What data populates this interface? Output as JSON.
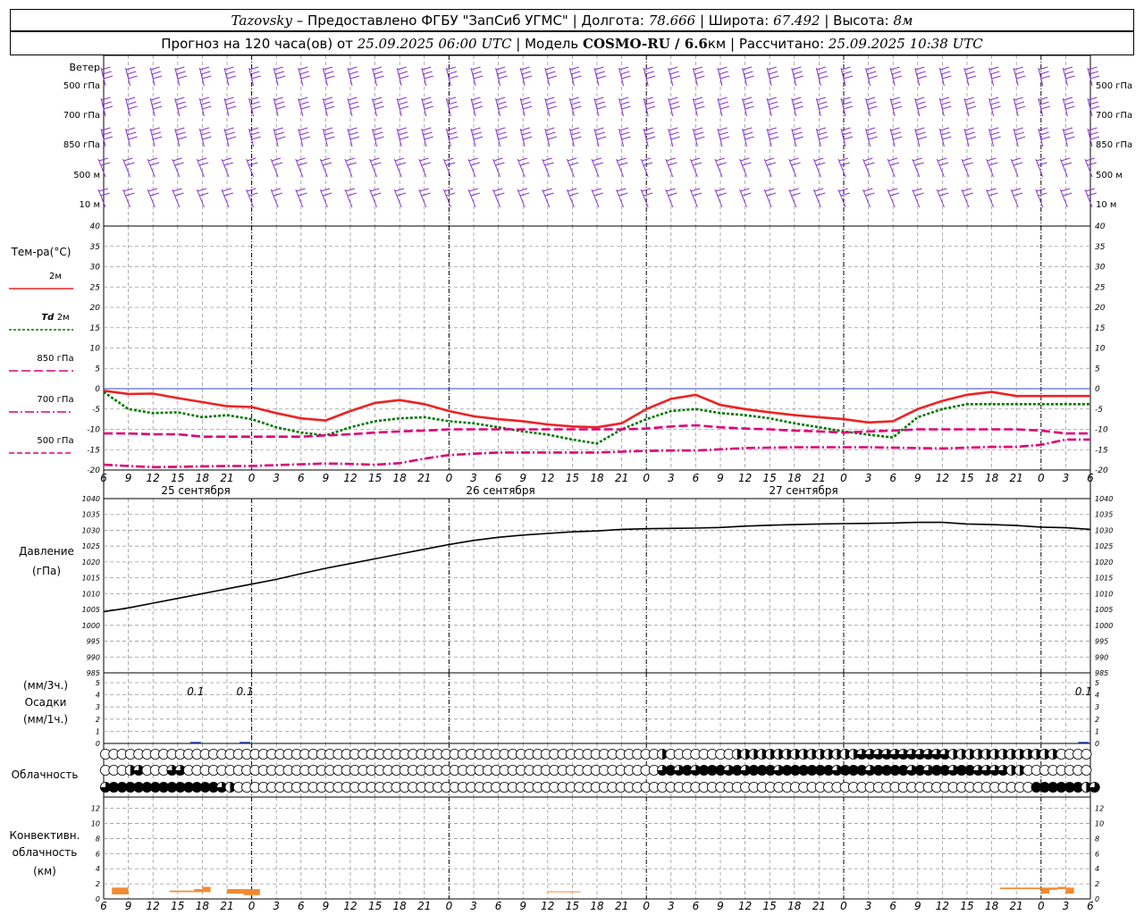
{
  "header": {
    "station": "Tazovsky",
    "provider": " – Предоставлено ФГБУ \"ЗапСиб УГМС\" | ",
    "lon_label": "Долгота: ",
    "lon": "78.666",
    "lat_label": " | Широта: ",
    "lat": "67.492",
    "alt_label": " | Высота: ",
    "alt": "8м",
    "forecast_label": "Прогноз на 120 часа(ов) от ",
    "forecast_start": "25.09.2025 06:00 UTC",
    "model_label": " | Модель ",
    "model": "COSMO-RU / 6.6",
    "model_unit": "км",
    "calc_label": " | Рассчитано: ",
    "calc_time": "25.09.2025 10:38 UTC"
  },
  "labels": {
    "wind": "Ветер",
    "wind_levels": [
      "500 гПа",
      "700 гПа",
      "850 гПа",
      "500 м",
      "10 м"
    ],
    "temp_title": "Тем-ра(°C)",
    "temp_legend": [
      {
        "pre": "",
        "level": "2м",
        "color": "#ee2222",
        "dash": ""
      },
      {
        "pre": "Td",
        "level": "2м",
        "color": "#007700",
        "dash": "3,2"
      },
      {
        "pre": "",
        "level": "850 гПа",
        "color": "#dd0077",
        "dash": "10,4"
      },
      {
        "pre": "",
        "level": "700 гПа",
        "color": "#dd0077",
        "dash": "10,3,2,3"
      },
      {
        "pre": "",
        "level": "500 гПа",
        "color": "#dd0077",
        "dash": "6,3"
      }
    ],
    "dates": [
      "25 сентября",
      "26 сентября",
      "27 сентября"
    ],
    "pressure_title": "Давление",
    "pressure_unit": "(гПа)",
    "precip_unit3": "(мм/3ч.)",
    "precip_title": "Осадки",
    "precip_unit1": "(мм/1ч.)",
    "cloud_title": "Облачность",
    "conv_title": "Конвективн.",
    "conv_title2": "облачность",
    "conv_unit": "(км)"
  },
  "chart_data": [
    {
      "type": "wind-barbs",
      "levels": [
        "500 гПа",
        "700 гПа",
        "850 гПа",
        "500 м",
        "10 м"
      ],
      "color": "#8833cc"
    },
    {
      "type": "line",
      "ylabel": "Тем-ра(°C)",
      "ylim": [
        -20,
        40
      ],
      "yticks": [
        -20,
        -15,
        -10,
        -5,
        0,
        5,
        10,
        15,
        20,
        25,
        30,
        35,
        40
      ],
      "x_hours": [
        0,
        3,
        6,
        9,
        12,
        15,
        18,
        21,
        24,
        27,
        30,
        33,
        36,
        39,
        42,
        45,
        48,
        51,
        54,
        57,
        60,
        63,
        66,
        69,
        72,
        75,
        78,
        81,
        84,
        87,
        90,
        93,
        96,
        99,
        102,
        105,
        108,
        111,
        114,
        117,
        120
      ],
      "x_ticklabels": [
        "6",
        "9",
        "12",
        "15",
        "18",
        "21",
        "0",
        "3",
        "6",
        "9",
        "12",
        "15",
        "18",
        "21",
        "0",
        "3",
        "6",
        "9",
        "12",
        "15",
        "18",
        "21",
        "0",
        "3",
        "6",
        "9",
        "12",
        "15",
        "18",
        "21",
        "0",
        "3",
        "6",
        "9",
        "12",
        "15",
        "18",
        "21",
        "0",
        "3",
        "6",
        "9",
        "12"
      ],
      "series": [
        {
          "name": "2м",
          "color": "#ee2222",
          "values": [
            -0.5,
            -1.3,
            -1.2,
            -2.3,
            -3.3,
            -4.3,
            -4.5,
            -6,
            -7.3,
            -7.8,
            -5.5,
            -3.5,
            -2.8,
            -3.8,
            -5.5,
            -6.8,
            -7.5,
            -8,
            -8.8,
            -9.3,
            -9.5,
            -8.5,
            -5,
            -2.5,
            -1.5,
            -4,
            -5,
            -5.8,
            -6.5,
            -7,
            -7.5,
            -8.3,
            -8,
            -5,
            -3,
            -1.5,
            -0.8,
            -1.8,
            -1.8,
            -1.8,
            -1.8
          ]
        },
        {
          "name": "Td 2м",
          "color": "#007700",
          "dash": "3,2",
          "values": [
            -0.8,
            -5,
            -6,
            -5.8,
            -7,
            -6.5,
            -7.5,
            -9.5,
            -10.8,
            -11.5,
            -9.5,
            -8,
            -7.3,
            -7,
            -8,
            -8.5,
            -9.5,
            -10.5,
            -11.3,
            -12.5,
            -13.5,
            -10,
            -7.5,
            -5.5,
            -5,
            -6,
            -6.5,
            -7.3,
            -8.5,
            -9.5,
            -10.5,
            -11.3,
            -12,
            -7,
            -5,
            -3.8,
            -3.8,
            -3.8,
            -3.8,
            -3.8,
            -3.8
          ]
        },
        {
          "name": "850 гПа",
          "color": "#dd0077",
          "dash": "10,4",
          "values": [
            -11,
            -11,
            -11.2,
            -11.2,
            -11.8,
            -11.8,
            -11.8,
            -11.8,
            -11.8,
            -11.5,
            -11.2,
            -10.8,
            -10.5,
            -10.3,
            -10,
            -10,
            -10,
            -10,
            -10,
            -10,
            -10,
            -10,
            -9.8,
            -9.3,
            -9,
            -9.5,
            -9.8,
            -10,
            -10.3,
            -10.5,
            -10.8,
            -10.5,
            -10.3,
            -10,
            -10,
            -10,
            -10,
            -10,
            -10.3,
            -11,
            -11
          ]
        },
        {
          "name": "700 гПа",
          "color": "#dd0077",
          "dash": "10,3,2,3",
          "values": [
            -18.7,
            -19,
            -19.3,
            -19.2,
            -19.1,
            -19,
            -19,
            -18.8,
            -18.6,
            -18.4,
            -18.5,
            -18.7,
            -18.3,
            -17.2,
            -16.3,
            -16,
            -15.7,
            -15.7,
            -15.7,
            -15.7,
            -15.7,
            -15.5,
            -15.3,
            -15.2,
            -15.2,
            -14.9,
            -14.6,
            -14.5,
            -14.4,
            -14.4,
            -14.4,
            -14.4,
            -14.5,
            -14.6,
            -14.7,
            -14.5,
            -14.3,
            -14.3,
            -13.8,
            -12.5,
            -12.5
          ]
        }
      ]
    },
    {
      "type": "line",
      "ylabel": "Давление",
      "ylim": [
        985,
        1040
      ],
      "yticks": [
        985,
        990,
        995,
        1000,
        1005,
        1010,
        1015,
        1020,
        1025,
        1030,
        1035,
        1040
      ],
      "series": [
        {
          "name": "Давление",
          "color": "#000000",
          "values": [
            1004.3,
            1005.5,
            1007,
            1008.5,
            1010,
            1011.5,
            1013,
            1014.5,
            1016.3,
            1018,
            1019.5,
            1021,
            1022.5,
            1024,
            1025.5,
            1026.8,
            1027.8,
            1028.5,
            1029,
            1029.5,
            1029.8,
            1030.3,
            1030.5,
            1030.6,
            1030.7,
            1030.9,
            1031.3,
            1031.6,
            1031.8,
            1032,
            1032.1,
            1032.2,
            1032.3,
            1032.5,
            1032.5,
            1032,
            1031.8,
            1031.5,
            1031,
            1030.8,
            1030.3
          ]
        }
      ]
    },
    {
      "type": "bar",
      "ylabel": "Осадки",
      "ylim": [
        0,
        5
      ],
      "yticks": [
        0,
        1,
        2,
        3,
        4,
        5
      ],
      "totals_3h": [
        {
          "hour": 9,
          "value": "0.1"
        },
        {
          "hour": 15,
          "value": "0.1"
        },
        {
          "hour": 117,
          "value": "0.1"
        }
      ]
    },
    {
      "type": "cloud-cover",
      "ylabel": "Облачность",
      "rows": [
        {
          "level": "верхняя",
          "eighths": [
            0,
            0,
            0,
            0,
            0,
            0,
            0,
            0,
            0,
            0,
            0,
            0,
            0,
            0,
            0,
            0,
            0,
            0,
            0,
            0,
            0,
            0,
            0,
            0,
            0,
            0,
            0,
            0,
            0,
            0,
            0,
            0,
            0,
            0,
            0,
            0,
            0,
            0,
            0,
            0,
            0,
            0,
            0,
            0,
            0,
            0,
            0,
            0,
            0,
            0,
            0,
            0,
            0,
            0,
            0,
            0,
            0,
            0,
            0,
            0,
            0,
            0,
            0,
            0,
            0,
            0,
            0,
            4,
            0,
            0,
            0,
            0,
            0,
            0,
            0,
            0,
            4,
            4,
            4,
            4,
            4,
            4,
            4,
            4,
            4,
            4,
            4,
            4,
            4,
            4,
            4,
            6,
            6,
            6,
            6,
            6,
            6,
            6,
            6,
            6,
            6,
            6,
            4,
            4,
            4,
            4,
            4,
            4,
            4,
            4,
            4,
            4,
            4,
            4,
            4,
            0,
            0,
            0,
            0
          ]
        },
        {
          "level": "средняя",
          "eighths": [
            0,
            0,
            0,
            4,
            6,
            0,
            0,
            0,
            6,
            6,
            0,
            0,
            0,
            0,
            0,
            0,
            0,
            0,
            0,
            0,
            0,
            0,
            0,
            0,
            0,
            0,
            0,
            0,
            0,
            0,
            0,
            0,
            0,
            0,
            0,
            0,
            0,
            0,
            0,
            0,
            0,
            0,
            0,
            0,
            0,
            0,
            0,
            0,
            0,
            0,
            0,
            0,
            0,
            0,
            0,
            0,
            0,
            0,
            0,
            0,
            0,
            0,
            0,
            0,
            0,
            0,
            0,
            6,
            8,
            6,
            8,
            6,
            8,
            8,
            8,
            6,
            8,
            6,
            8,
            8,
            8,
            6,
            8,
            8,
            8,
            8,
            8,
            8,
            6,
            8,
            8,
            8,
            6,
            8,
            8,
            8,
            8,
            6,
            8,
            6,
            8,
            8,
            6,
            8,
            8,
            6,
            6,
            6,
            6,
            4,
            4,
            0,
            0,
            0,
            0,
            0,
            0,
            0,
            0
          ]
        },
        {
          "level": "нижняя",
          "eighths": [
            6,
            8,
            8,
            8,
            8,
            8,
            8,
            8,
            8,
            8,
            8,
            8,
            8,
            8,
            6,
            4,
            0,
            0,
            0,
            0,
            0,
            0,
            0,
            0,
            0,
            0,
            0,
            0,
            0,
            0,
            0,
            0,
            0,
            0,
            0,
            0,
            0,
            0,
            0,
            0,
            0,
            0,
            0,
            0,
            0,
            0,
            0,
            0,
            0,
            0,
            0,
            0,
            0,
            0,
            0,
            0,
            0,
            0,
            0,
            0,
            0,
            0,
            0,
            0,
            0,
            0,
            0,
            0,
            0,
            0,
            0,
            0,
            0,
            0,
            0,
            0,
            0,
            0,
            0,
            0,
            0,
            0,
            0,
            0,
            0,
            0,
            0,
            0,
            0,
            0,
            0,
            0,
            0,
            0,
            0,
            0,
            0,
            0,
            0,
            0,
            0,
            0,
            0,
            0,
            0,
            0,
            0,
            0,
            0,
            0,
            0,
            0,
            8,
            8,
            8,
            8,
            8,
            8,
            4,
            6,
            6
          ]
        }
      ]
    },
    {
      "type": "bar",
      "ylabel": "Конвективн. облачность (км)",
      "ylim": [
        0,
        13
      ],
      "yticks": [
        0,
        2,
        4,
        6,
        8,
        10,
        12
      ],
      "color": "#f28a30",
      "bars": [
        {
          "from": 1,
          "to": 3,
          "bottom": 0.6,
          "top": 1.5
        },
        {
          "from": 8,
          "to": 11,
          "bottom": 0.9,
          "top": 1.1
        },
        {
          "from": 11,
          "to": 12,
          "bottom": 0.9,
          "top": 1.3
        },
        {
          "from": 12,
          "to": 13,
          "bottom": 0.9,
          "top": 1.6
        },
        {
          "from": 15,
          "to": 17,
          "bottom": 0.7,
          "top": 1.3
        },
        {
          "from": 17,
          "to": 19,
          "bottom": 0.5,
          "top": 1.3
        },
        {
          "from": 54,
          "to": 58,
          "bottom": 0.9,
          "top": 1.0
        },
        {
          "from": 109,
          "to": 114,
          "bottom": 1.3,
          "top": 1.5
        },
        {
          "from": 114,
          "to": 115,
          "bottom": 0.7,
          "top": 1.5
        },
        {
          "from": 115,
          "to": 116,
          "bottom": 1.2,
          "top": 1.5
        },
        {
          "from": 116,
          "to": 117,
          "bottom": 1.3,
          "top": 1.6
        },
        {
          "from": 117,
          "to": 118,
          "bottom": 0.7,
          "top": 1.5
        }
      ]
    }
  ]
}
